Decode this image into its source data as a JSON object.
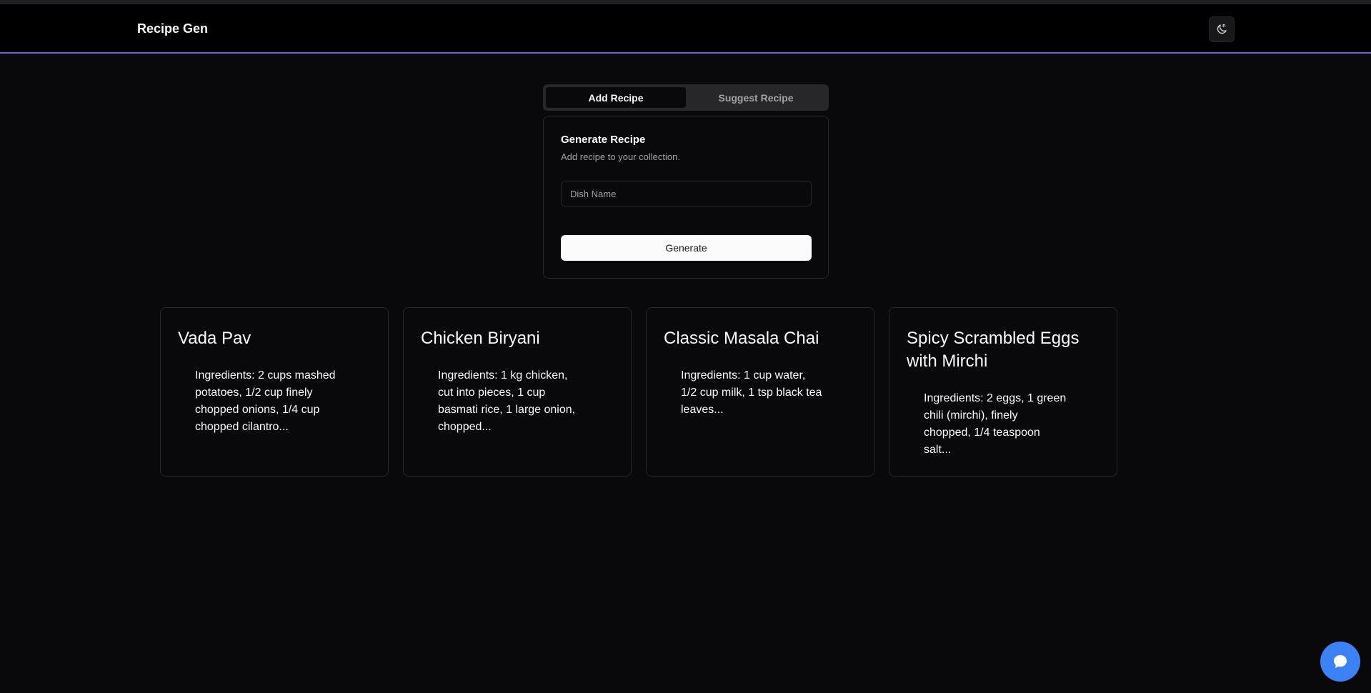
{
  "app": {
    "brand": "Recipe Gen",
    "accent_color": "#6b63d9"
  },
  "header": {
    "theme_toggle_icon": "moon-sun-icon"
  },
  "tabs": [
    {
      "label": "Add Recipe",
      "active": true
    },
    {
      "label": "Suggest Recipe",
      "active": false
    }
  ],
  "generate_card": {
    "title": "Generate Recipe",
    "description": "Add recipe to your collection.",
    "dish_input": {
      "placeholder": "Dish Name",
      "value": ""
    },
    "button_label": "Generate"
  },
  "recipes": [
    {
      "title": "Vada Pav",
      "ingredients": "Ingredients: 2 cups mashed potatoes, 1/2 cup finely chopped onions, 1/4 cup chopped cilantro..."
    },
    {
      "title": "Chicken Biryani",
      "ingredients": "Ingredients: 1 kg chicken, cut into pieces, 1 cup basmati rice, 1 large onion, chopped..."
    },
    {
      "title": "Classic Masala Chai",
      "ingredients": "Ingredients: 1 cup water, 1/2 cup milk, 1 tsp black tea leaves..."
    },
    {
      "title": "Spicy Scrambled Eggs with Mirchi",
      "ingredients": "Ingredients: 2 eggs, 1 green chili (mirchi), finely chopped, 1/4 teaspoon salt..."
    }
  ],
  "chat": {
    "icon": "chat-bubble-icon",
    "color": "#3b82f6"
  }
}
